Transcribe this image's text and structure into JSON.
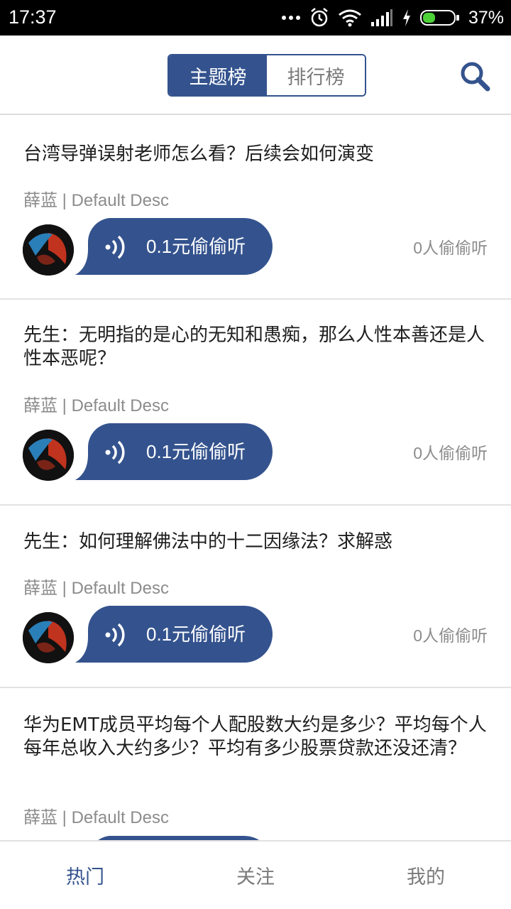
{
  "status_bar": {
    "time": "17:37",
    "battery_percent": "37%",
    "icons": [
      "more-dots-icon",
      "alarm-icon",
      "wifi-icon",
      "signal-icon",
      "charging-icon",
      "battery-icon"
    ]
  },
  "header": {
    "tabs": [
      {
        "label": "主题榜",
        "active": true
      },
      {
        "label": "排行榜",
        "active": false
      }
    ],
    "search_icon": "search-icon",
    "accent_color": "#34538e"
  },
  "feed": {
    "items": [
      {
        "title": "台湾导弹误射老师怎么看？后续会如何演变",
        "author": "薛蓝",
        "separator": " | ",
        "desc": "Default Desc",
        "listen_label": "0.1元偷偷听",
        "listen_count": "0人偷偷听"
      },
      {
        "title": "先生：无明指的是心的无知和愚痴，那么人性本善还是人性本恶呢？",
        "author": "薛蓝",
        "separator": " | ",
        "desc": "Default Desc",
        "listen_label": "0.1元偷偷听",
        "listen_count": "0人偷偷听"
      },
      {
        "title": "先生：如何理解佛法中的十二因缘法？求解惑",
        "author": "薛蓝",
        "separator": " | ",
        "desc": "Default Desc",
        "listen_label": "0.1元偷偷听",
        "listen_count": "0人偷偷听"
      },
      {
        "title": "华为EMT成员平均每个人配股数大约是多少？平均每个人每年总收入大约多少？平均有多少股票贷款还没还清？",
        "author": "薛蓝",
        "separator": " | ",
        "desc": "Default Desc"
      }
    ]
  },
  "bottom_nav": {
    "items": [
      {
        "label": "热门",
        "active": true
      },
      {
        "label": "关注",
        "active": false
      },
      {
        "label": "我的",
        "active": false
      }
    ]
  }
}
